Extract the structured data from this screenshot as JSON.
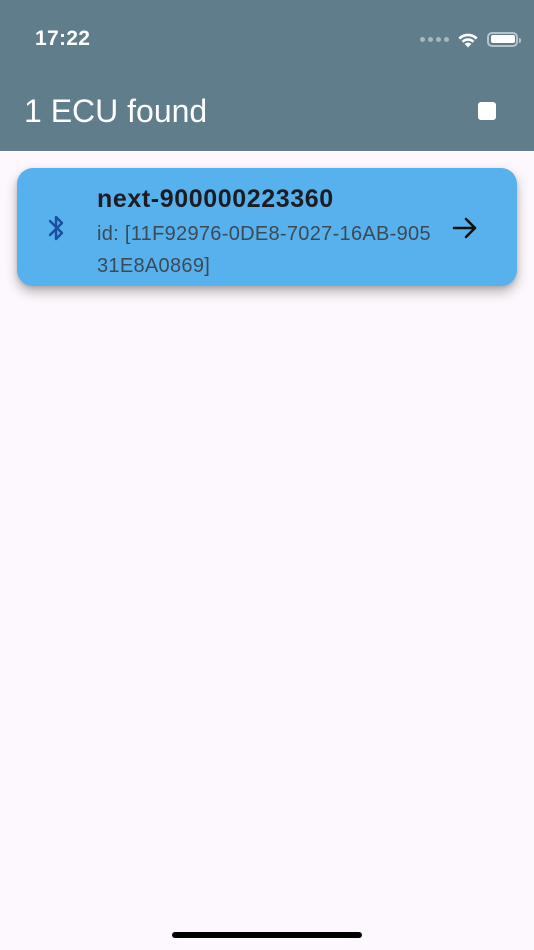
{
  "status_bar": {
    "time": "17:22"
  },
  "app_bar": {
    "title": "1 ECU found",
    "action_icon": "stop-icon"
  },
  "devices": [
    {
      "name": "next-900000223360",
      "id_text": "id: [11F92976-0DE8-7027-16AB-90531E8A0869]",
      "leading_icon": "bluetooth-icon",
      "trailing_icon": "arrow-right-icon"
    }
  ],
  "colors": {
    "app_bar": "#607d8b",
    "card": "#56b1ec",
    "background": "#fdf8fd",
    "bluetooth_icon": "#1a4fa0"
  }
}
